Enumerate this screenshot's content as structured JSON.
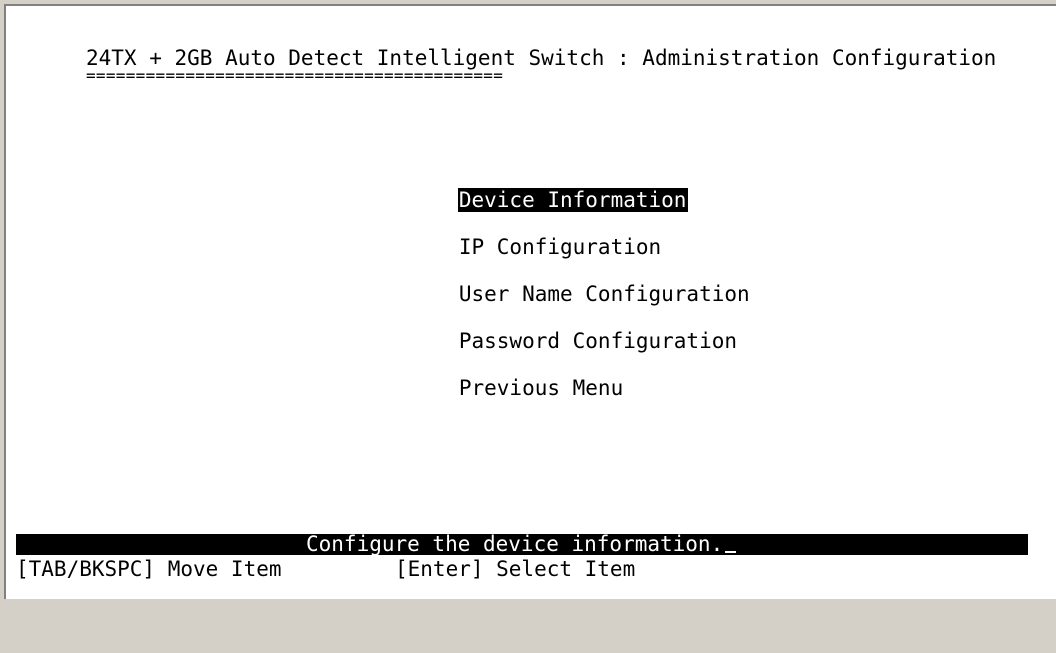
{
  "header": {
    "title": "24TX + 2GB Auto Detect Intelligent Switch : Administration Configuration",
    "underline": "=========================================="
  },
  "menu": {
    "items": [
      {
        "label": "Device Information",
        "selected": true
      },
      {
        "label": "IP Configuration",
        "selected": false
      },
      {
        "label": "User Name Configuration",
        "selected": false
      },
      {
        "label": "Password Configuration",
        "selected": false
      },
      {
        "label": "Previous Menu",
        "selected": false
      }
    ]
  },
  "status": {
    "message": "Configure the device information."
  },
  "help": {
    "move": "[TAB/BKSPC] Move Item",
    "select": "[Enter] Select Item"
  },
  "colors": {
    "background": "#ffffff",
    "text": "#000000",
    "highlight_bg": "#000000",
    "highlight_fg": "#ffffff"
  }
}
